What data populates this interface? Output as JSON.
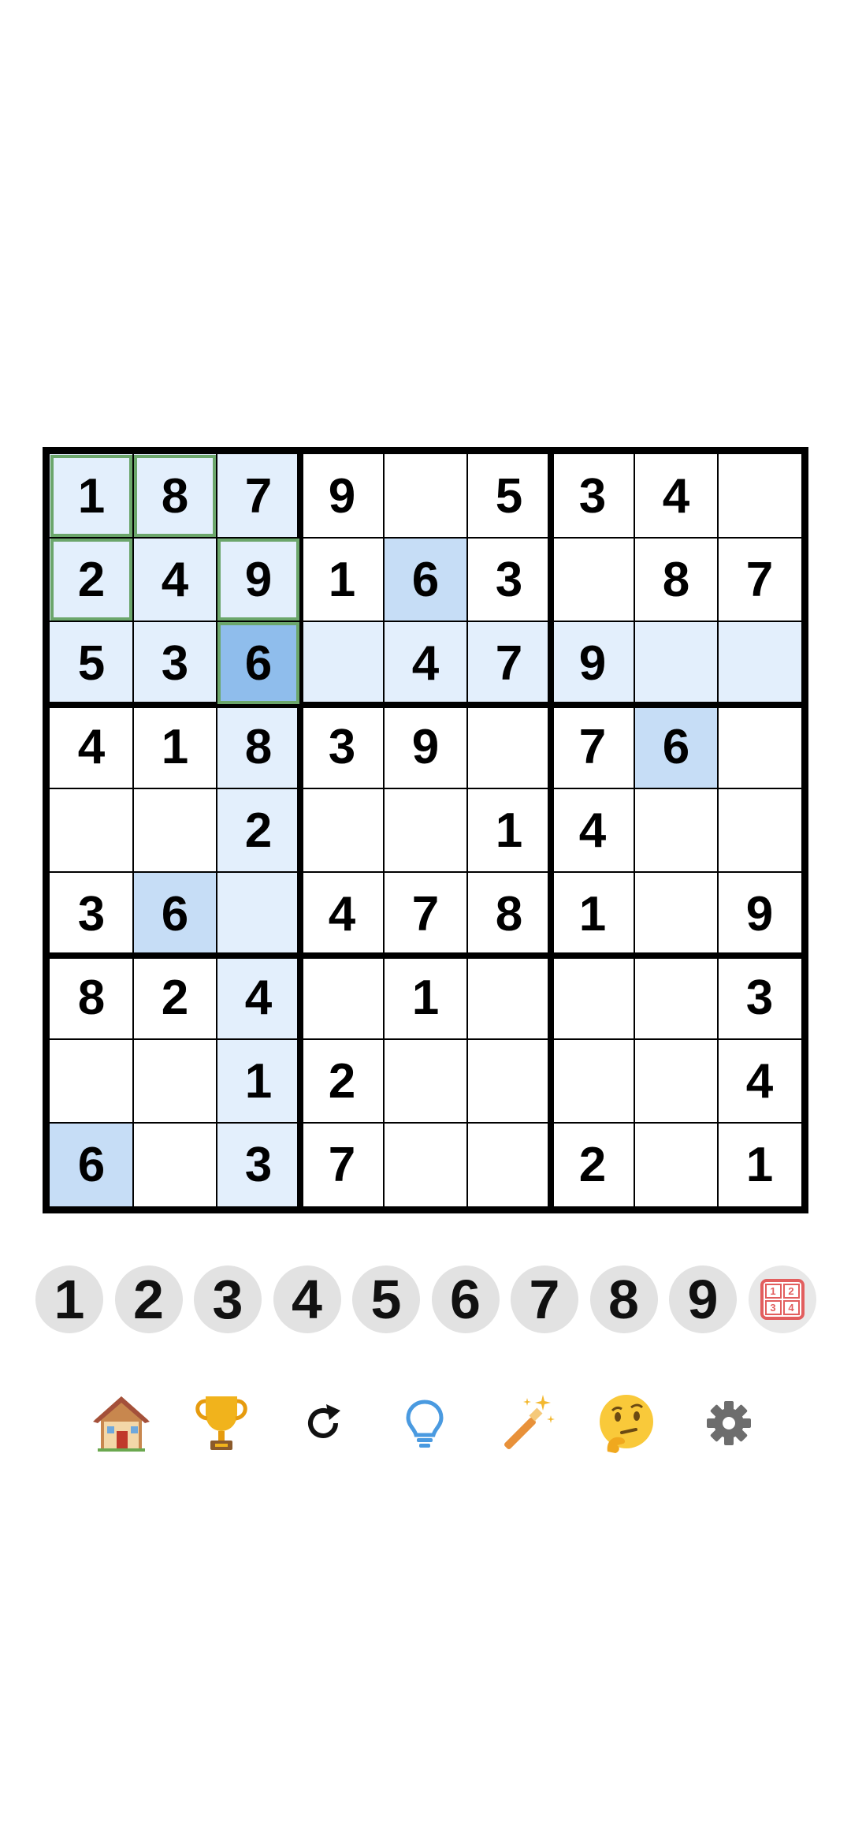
{
  "grid": [
    [
      "1",
      "8",
      "7",
      "9",
      "",
      "5",
      "3",
      "4",
      ""
    ],
    [
      "2",
      "4",
      "9",
      "1",
      "6",
      "3",
      "",
      "8",
      "7"
    ],
    [
      "5",
      "3",
      "6",
      "",
      "4",
      "7",
      "9",
      "",
      ""
    ],
    [
      "4",
      "1",
      "8",
      "3",
      "9",
      "",
      "7",
      "6",
      ""
    ],
    [
      "",
      "",
      "2",
      "",
      "",
      "1",
      "4",
      "",
      ""
    ],
    [
      "3",
      "6",
      "",
      "4",
      "7",
      "8",
      "1",
      "",
      "9"
    ],
    [
      "8",
      "2",
      "4",
      "",
      "1",
      "",
      "",
      "",
      "3"
    ],
    [
      "",
      "",
      "1",
      "2",
      "",
      "",
      "",
      "",
      "4"
    ],
    [
      "6",
      "",
      "3",
      "7",
      "",
      "",
      "2",
      "",
      "1"
    ]
  ],
  "selected_cell": {
    "row": 3,
    "col": 3
  },
  "numpad": [
    "1",
    "2",
    "3",
    "4",
    "5",
    "6",
    "7",
    "8",
    "9"
  ],
  "notes_button": {
    "digits": [
      "1",
      "2",
      "3",
      "4"
    ]
  },
  "toolbar": [
    {
      "icon": "home-icon"
    },
    {
      "icon": "trophy-icon"
    },
    {
      "icon": "restart-icon"
    },
    {
      "icon": "hint-lightbulb-icon"
    },
    {
      "icon": "magic-wand-icon"
    },
    {
      "icon": "thinking-face-icon"
    },
    {
      "icon": "settings-gear-icon"
    }
  ],
  "colors": {
    "highlight": "#e3effc",
    "same_number": "#c6ddf6",
    "selected": "#8fbdec",
    "note_outline": "#6ba66b",
    "notes_accent": "#e25e5e"
  }
}
